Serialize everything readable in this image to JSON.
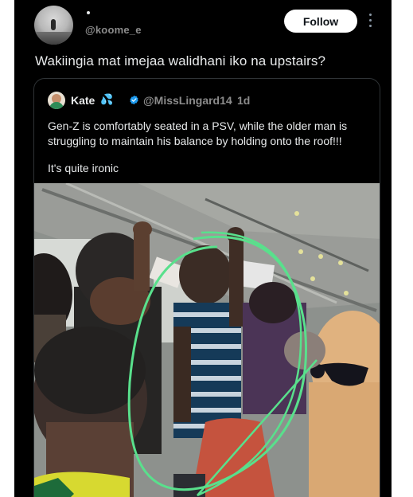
{
  "author": {
    "handle": "@koome_e"
  },
  "follow_label": "Follow",
  "post_text": "Wakiingia mat imejaa walidhani iko na upstairs?",
  "quoted": {
    "name": "Kate",
    "emoji_1": "💦",
    "emoji_2": "😍",
    "handle": "@MissLingard14",
    "separator": "·",
    "time": "1d",
    "text": "Gen-Z is comfortably seated in a PSV, while the older man is struggling to maintain his balance by holding onto the roof!!!",
    "text_2": "It's quite ironic"
  },
  "colors": {
    "background": "#000000",
    "text": "#e7e9ea",
    "muted": "#8b8b8b",
    "verified": "#1d9bf0",
    "annotation_circle": "#59e08c"
  },
  "icons": [
    "avatar",
    "more-icon",
    "verified-icon"
  ]
}
